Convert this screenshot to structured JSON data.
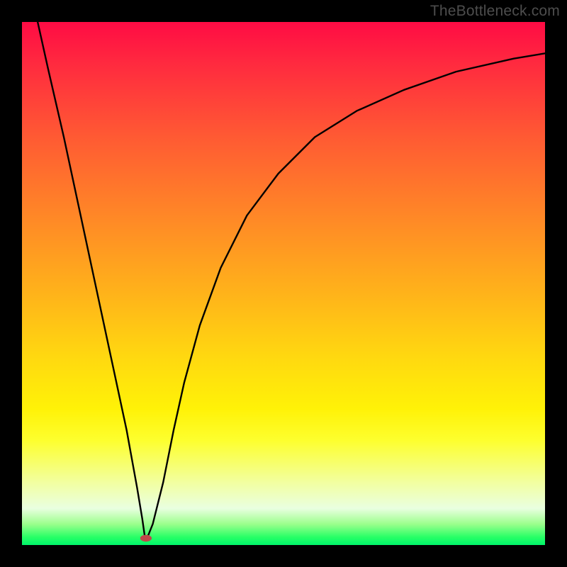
{
  "watermark": "TheBottleneck.com",
  "chart_data": {
    "type": "line",
    "title": "",
    "xlabel": "",
    "ylabel": "",
    "xlim": [
      0,
      100
    ],
    "ylim": [
      0,
      100
    ],
    "grid": false,
    "legend": false,
    "series": [
      {
        "name": "curve",
        "x": [
          3,
          5,
          8,
          11,
          14,
          17,
          20,
          22,
          23,
          23.5,
          24,
          25,
          27,
          29,
          31,
          34,
          38,
          43,
          49,
          56,
          64,
          73,
          83,
          94,
          100
        ],
        "y": [
          100,
          91,
          78,
          64,
          50,
          36,
          22,
          11,
          5,
          1.5,
          1.5,
          4,
          12,
          22,
          31,
          42,
          53,
          63,
          71,
          78,
          83,
          87,
          90.5,
          93,
          94
        ]
      }
    ],
    "marker": {
      "cx": 23.7,
      "cy": 1.3,
      "rx": 1.1,
      "ry": 0.65,
      "fill": "#c0474a"
    },
    "background_gradient_stops": [
      {
        "pos": 0,
        "color": "#ff0b44"
      },
      {
        "pos": 0.8,
        "color": "#fdff2e"
      },
      {
        "pos": 1.0,
        "color": "#00f56a"
      }
    ]
  }
}
